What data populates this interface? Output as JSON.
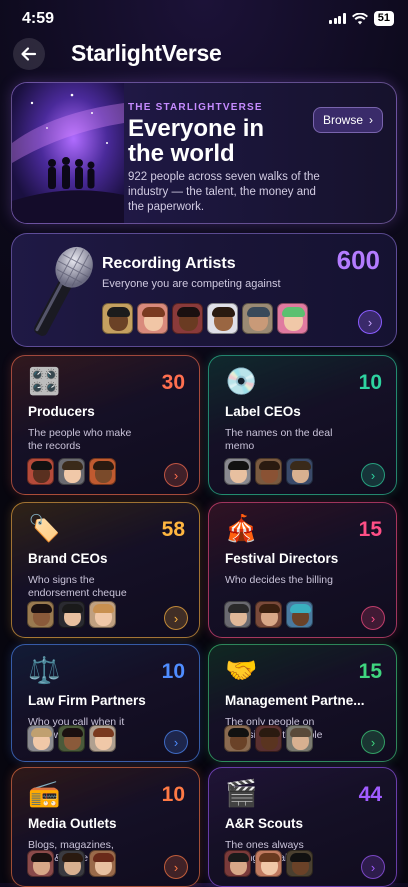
{
  "status": {
    "time": "4:59",
    "battery": "51"
  },
  "header": {
    "title": "StarlightVerse"
  },
  "hero": {
    "eyebrow": "THE STARLIGHTVERSE",
    "title": "Everyone in the world",
    "description": "922 people across seven walks of the industry — the talent, the money and the paperwork.",
    "browse_label": "Browse"
  },
  "artists": {
    "title": "Recording Artists",
    "subtitle": "Everyone you are competing against",
    "count": "600",
    "accent": "#b47cff"
  },
  "categories": [
    {
      "title": "Producers",
      "desc": "The people who make the records",
      "count": "30",
      "accent": "#ff6f4f",
      "icon": "mixer-icon"
    },
    {
      "title": "Label CEOs",
      "desc": "The names on the deal memo",
      "count": "10",
      "accent": "#2ed3a0",
      "icon": "disc-icon"
    },
    {
      "title": "Brand CEOs",
      "desc": "Who signs the endorsement cheque",
      "count": "58",
      "accent": "#ffb640",
      "icon": "tag-icon"
    },
    {
      "title": "Festival Directors",
      "desc": "Who decides the billing",
      "count": "15",
      "accent": "#ff4f86",
      "icon": "circus-tent-icon"
    },
    {
      "title": "Law Firm Partners",
      "desc": "Who you call when it goes wrong",
      "count": "10",
      "accent": "#4f8dff",
      "icon": "scales-icon"
    },
    {
      "title": "Management Partne...",
      "desc": "The only people on your side of the table",
      "count": "15",
      "accent": "#3fd67f",
      "icon": "handshake-icon"
    },
    {
      "title": "Media Outlets",
      "desc": "Blogs, magazines, radio & more",
      "count": "10",
      "accent": "#ff7a45",
      "icon": "radio-icon"
    },
    {
      "title": "A&R Scouts",
      "desc": "The ones always looking for talent",
      "count": "44",
      "accent": "#a05cff",
      "icon": "clapperboard-icon"
    }
  ]
}
